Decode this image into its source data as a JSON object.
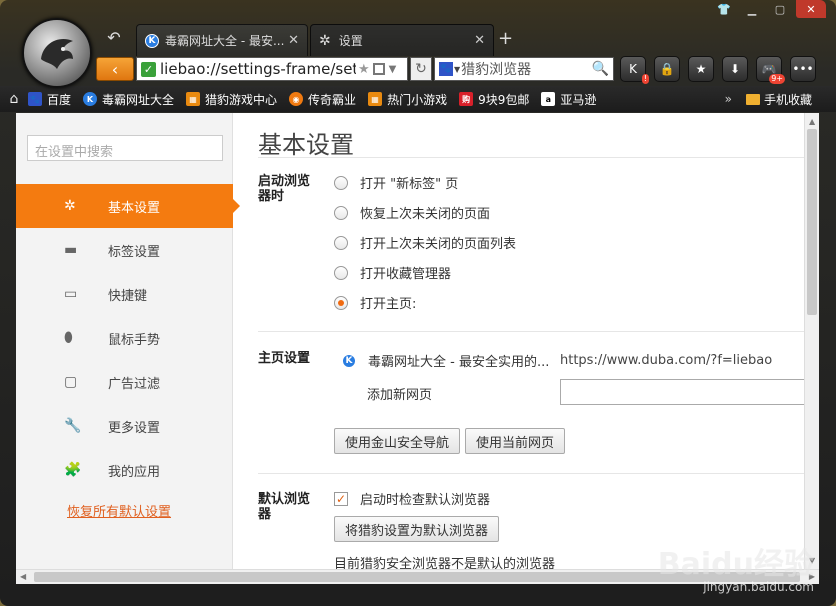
{
  "tabs": [
    {
      "label": "毒霸网址大全 - 最安..."
    },
    {
      "label": "设置"
    }
  ],
  "address": {
    "url": "liebao://settings-frame/set",
    "search_placeholder": "猎豹浏览器"
  },
  "toolbar": {
    "k_badge": "!",
    "game_badge": "9+"
  },
  "bookmarks": [
    {
      "label": "百度"
    },
    {
      "label": "毒霸网址大全"
    },
    {
      "label": "猎豹游戏中心"
    },
    {
      "label": "传奇霸业"
    },
    {
      "label": "热门小游戏"
    },
    {
      "label": "9块9包邮"
    },
    {
      "label": "亚马逊"
    }
  ],
  "bookmarks_more": "»",
  "mobile_favorites": "手机收藏",
  "sidebar": {
    "search_placeholder": "在设置中搜索",
    "items": [
      {
        "label": "基本设置",
        "icon": "gear-icon",
        "active": true
      },
      {
        "label": "标签设置",
        "icon": "tab-icon"
      },
      {
        "label": "快捷键",
        "icon": "shortcut-icon"
      },
      {
        "label": "鼠标手势",
        "icon": "mouse-icon"
      },
      {
        "label": "广告过滤",
        "icon": "window-icon"
      },
      {
        "label": "更多设置",
        "icon": "wrench-icon"
      },
      {
        "label": "我的应用",
        "icon": "puzzle-icon"
      }
    ],
    "restore_label": "恢复所有默认设置"
  },
  "main": {
    "title": "基本设置",
    "startup": {
      "label": "启动浏览器时",
      "options": [
        {
          "label": "打开 \"新标签\" 页",
          "selected": false
        },
        {
          "label": "恢复上次未关闭的页面",
          "selected": false
        },
        {
          "label": "打开上次未关闭的页面列表",
          "selected": false
        },
        {
          "label": "打开收藏管理器",
          "selected": false
        },
        {
          "label": "打开主页:",
          "selected": true
        }
      ]
    },
    "homepage": {
      "label": "主页设置",
      "entry_title": "毒霸网址大全 - 最安全实用的...",
      "entry_url": "https://www.duba.com/?f=liebao",
      "add_label": "添加新网页",
      "btn_kingsoft": "使用金山安全导航",
      "btn_current": "使用当前网页"
    },
    "default_browser": {
      "label": "默认浏览器",
      "check_label": "启动时检查默认浏览器",
      "checked": true,
      "btn_set_default": "将猎豹设置为默认浏览器",
      "status": "目前猎豹安全浏览器不是默认的浏览器"
    }
  },
  "watermark": {
    "brand": "Baidu经验",
    "url": "jingyan.baidu.com"
  },
  "colors": {
    "accent": "#f47b10",
    "restore_link": "#e06020"
  }
}
